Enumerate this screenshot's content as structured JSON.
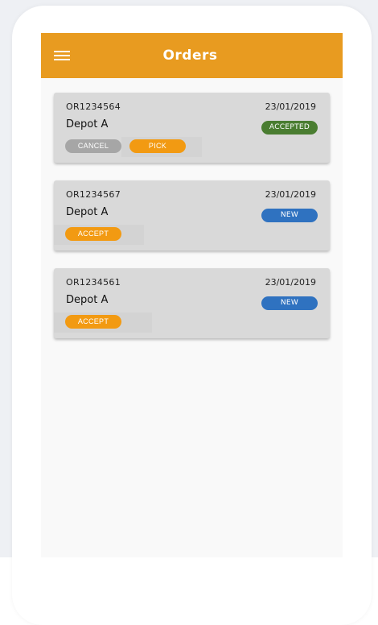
{
  "appbar": {
    "title": "Orders",
    "menu_icon": "hamburger-menu-icon",
    "color": "#e89b20"
  },
  "orders": [
    {
      "id": "OR1234564",
      "date": "23/01/2019",
      "depot": "Depot A",
      "status": "ACCEPTED",
      "status_color": "#4a7d31",
      "actions": [
        "CANCEL",
        "PICK"
      ]
    },
    {
      "id": "OR1234567",
      "date": "23/01/2019",
      "depot": "Depot A",
      "status": "NEW",
      "status_color": "#2f72c0",
      "actions": [
        "ACCEPT"
      ]
    },
    {
      "id": "OR1234561",
      "date": "23/01/2019",
      "depot": "Depot A",
      "status": "NEW",
      "status_color": "#2f72c0",
      "actions": [
        "ACCEPT"
      ]
    }
  ]
}
